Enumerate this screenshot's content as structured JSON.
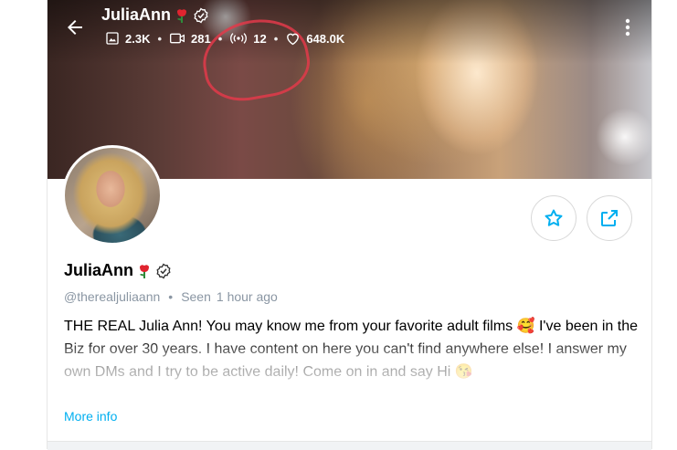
{
  "profile": {
    "display_name": "JuliaAnn",
    "handle": "@therealjuliaann",
    "seen_label": "Seen",
    "seen_time": "1 hour ago",
    "bio": "THE REAL Julia Ann! You may know me from your favorite adult films 🥰 I've been in the Biz for over 30 years. I have content on here you can't find anywhere else! I answer my own DMs and I try to be active daily! Come on in and say Hi 😘",
    "more_info_label": "More info"
  },
  "stats": {
    "photos": "2.3K",
    "videos": "281",
    "streams": "12",
    "likes": "648.0K"
  },
  "icons": {
    "back": "arrow-left-icon",
    "more": "more-vertical-icon",
    "verified": "verified-badge-icon",
    "rose": "rose-icon",
    "favorite": "star-icon",
    "share": "share-icon",
    "photos": "image-icon",
    "videos": "video-icon",
    "streams": "broadcast-icon",
    "likes": "heart-icon"
  },
  "colors": {
    "accent": "#00aff0",
    "muted": "#8a96a3"
  }
}
